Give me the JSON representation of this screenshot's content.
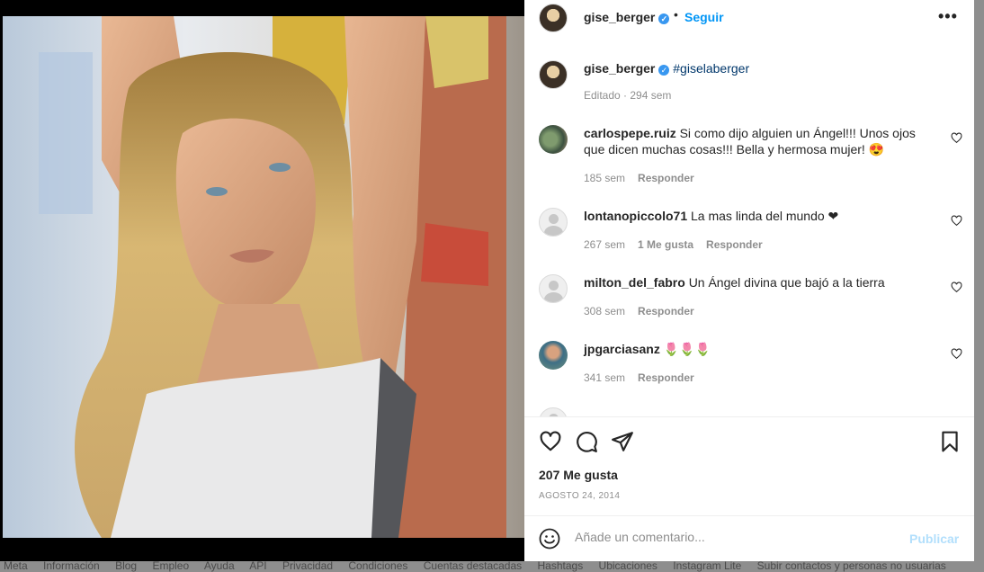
{
  "post": {
    "author": "gise_berger",
    "follow_label": "Seguir",
    "header_dot": "•",
    "more_label": "•••",
    "caption": "#giselaberger",
    "caption_meta": "Editado · 294 sem",
    "likes": "207 Me gusta",
    "date": "AGOSTO 24, 2014"
  },
  "comments": [
    {
      "user": "carlospepe.ruiz",
      "text": "Si como dijo alguien un Ángel!!! Unos ojos que dicen muchas cosas!!! Bella y hermosa mujer! 😍",
      "time": "185 sem",
      "likes": "",
      "reply": "Responder"
    },
    {
      "user": "lontanopiccolo71",
      "text": "La mas linda del mundo ❤",
      "time": "267 sem",
      "likes": "1 Me gusta",
      "reply": "Responder"
    },
    {
      "user": "milton_del_fabro",
      "text": "Un Ángel divina que bajó a la tierra",
      "time": "308 sem",
      "likes": "",
      "reply": "Responder"
    },
    {
      "user": "jpgarciasanz",
      "text": "🌷🌷🌷",
      "time": "341 sem",
      "likes": "",
      "reply": "Responder"
    }
  ],
  "add_comment": {
    "placeholder": "Añade un comentario...",
    "publish_label": "Publicar"
  },
  "footer": {
    "links": [
      "Meta",
      "Información",
      "Blog",
      "Empleo",
      "Ayuda",
      "API",
      "Privacidad",
      "Condiciones",
      "Cuentas destacadas",
      "Hashtags",
      "Ubicaciones",
      "Instagram Lite",
      "Subir contactos y personas no usuarias"
    ]
  },
  "icons": {
    "like": "heart-icon",
    "comment": "comment-bubble-icon",
    "share": "paper-plane-icon",
    "save": "bookmark-icon",
    "emoji": "smiley-icon",
    "verified": "verified-badge-icon",
    "options": "more-options-icon"
  },
  "colors": {
    "accent": "#0095f6",
    "publish_disabled": "#b2dffc",
    "verified": "#3897f0",
    "secondary_text": "#8e8e8e"
  }
}
